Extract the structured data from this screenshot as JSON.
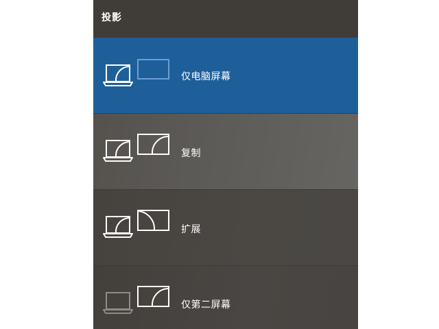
{
  "panel": {
    "title": "投影",
    "options": [
      {
        "label": "仅电脑屏幕",
        "selected": true,
        "icon": "pc-screen-only-icon"
      },
      {
        "label": "复制",
        "selected": false,
        "icon": "duplicate-icon"
      },
      {
        "label": "扩展",
        "selected": false,
        "icon": "extend-icon"
      },
      {
        "label": "仅第二屏幕",
        "selected": false,
        "icon": "second-screen-only-icon"
      }
    ]
  },
  "colors": {
    "accent": "#1f5f99",
    "panel_bg": "#3f3b37",
    "text": "#ffffff",
    "dim_icon": "#8e8b88",
    "selected_dim_icon": "#6a9fd4"
  }
}
